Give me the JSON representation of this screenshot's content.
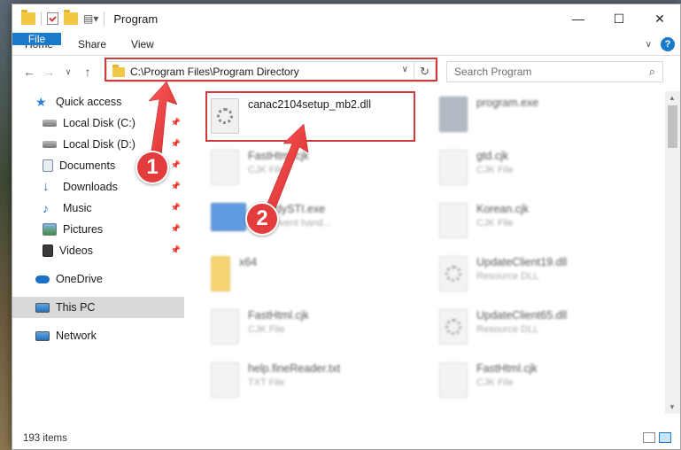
{
  "window": {
    "title": "Program"
  },
  "ribbon": {
    "tabs": [
      "File",
      "Home",
      "Share",
      "View"
    ],
    "help": "?"
  },
  "address_bar": {
    "path": "C:\\Program Files\\Program Directory",
    "refresh_icon": "refresh-icon"
  },
  "search": {
    "placeholder": "Search Program"
  },
  "sidebar": {
    "items": [
      {
        "label": "Quick access",
        "icon": "star-icon",
        "pinned": false
      },
      {
        "label": "Local Disk (C:)",
        "icon": "drive-icon",
        "pinned": true
      },
      {
        "label": "Local Disk (D:)",
        "icon": "drive-icon",
        "pinned": true
      },
      {
        "label": "Documents",
        "icon": "documents-icon",
        "pinned": true
      },
      {
        "label": "Downloads",
        "icon": "download-icon",
        "pinned": true
      },
      {
        "label": "Music",
        "icon": "music-icon",
        "pinned": true
      },
      {
        "label": "Pictures",
        "icon": "pictures-icon",
        "pinned": true
      },
      {
        "label": "Videos",
        "icon": "videos-icon",
        "pinned": true
      },
      {
        "label": "OneDrive",
        "icon": "cloud-icon",
        "pinned": false
      },
      {
        "label": "This PC",
        "icon": "pc-icon",
        "pinned": false
      },
      {
        "label": "Network",
        "icon": "network-icon",
        "pinned": false
      }
    ]
  },
  "files": {
    "highlighted": {
      "name": "canac2104setup_mb2.dll"
    },
    "left_column": [
      {
        "name": "FastHtml.cjk",
        "type": "CJK File"
      },
      {
        "name": "ReadySTI.exe",
        "type": "...or event hand..."
      },
      {
        "name": "x64",
        "type": ""
      },
      {
        "name": "FastHtml.cjk",
        "type": "CJK File"
      },
      {
        "name": "help.fineReader.txt",
        "type": "TXT File"
      }
    ],
    "right_column": [
      {
        "name": "program.exe",
        "type": ""
      },
      {
        "name": "gtd.cjk",
        "type": "CJK File"
      },
      {
        "name": "Korean.cjk",
        "type": "CJK File"
      },
      {
        "name": "UpdateClient19.dll",
        "type": "Resource DLL"
      },
      {
        "name": "UpdateClient65.dll",
        "type": "Resource DLL"
      },
      {
        "name": "FastHtml.cjk",
        "type": "CJK File"
      }
    ]
  },
  "status": {
    "item_count": "193 items"
  },
  "annotations": {
    "step1": "1",
    "step2": "2",
    "highlight_color": "#d2393a"
  }
}
